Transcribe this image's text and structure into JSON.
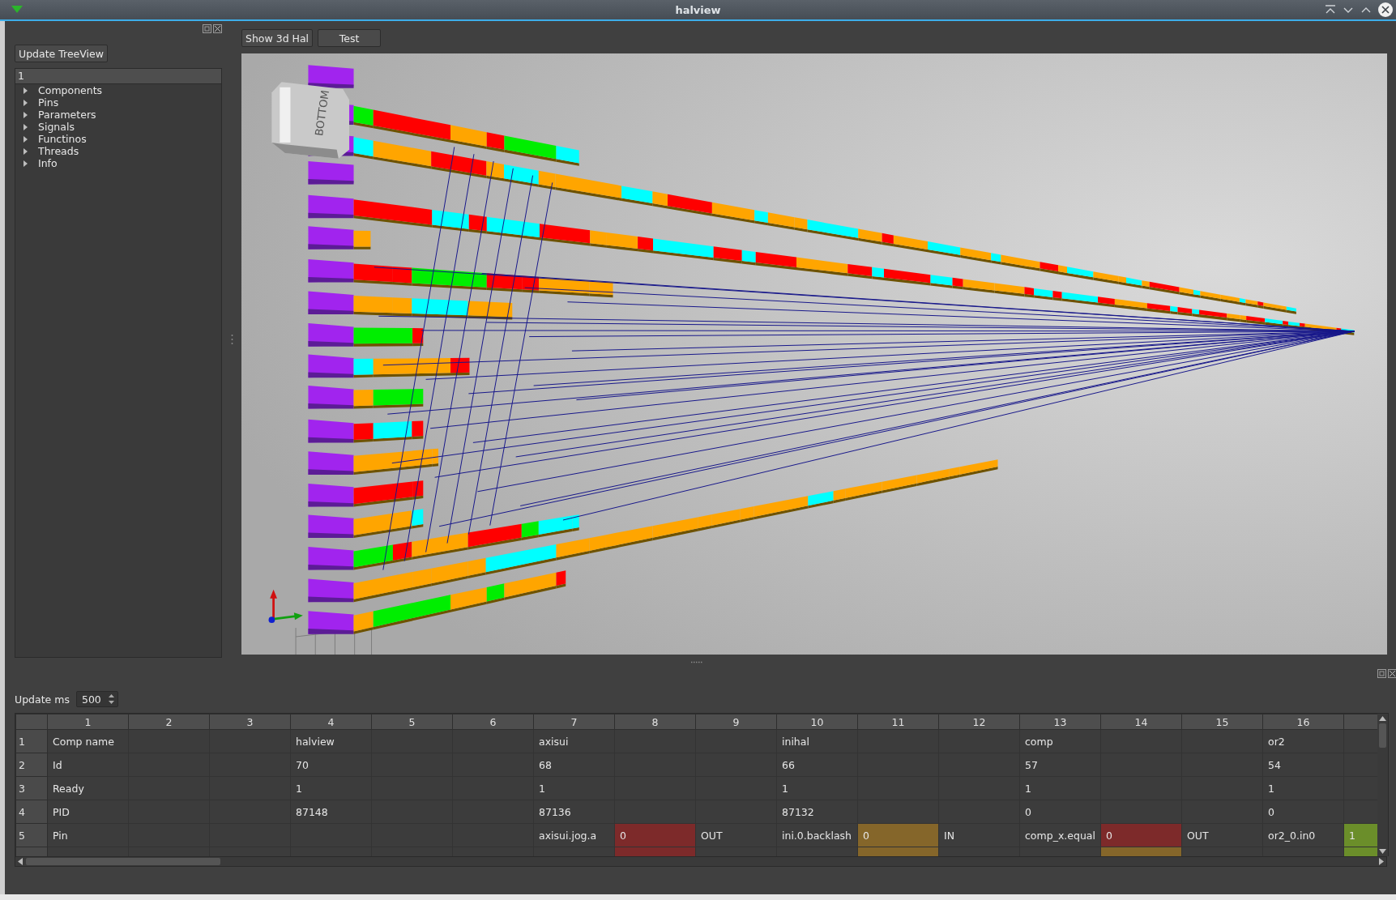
{
  "window": {
    "title": "halview"
  },
  "tree_panel": {
    "update_button": "Update TreeView",
    "header": "1",
    "items": [
      {
        "label": "Components",
        "expanded": false
      },
      {
        "label": "Pins",
        "expanded": false
      },
      {
        "label": "Parameters",
        "expanded": false
      },
      {
        "label": "Signals",
        "expanded": false
      },
      {
        "label": "Functinos",
        "expanded": false
      },
      {
        "label": "Threads",
        "expanded": false
      },
      {
        "label": "Info",
        "expanded": false
      }
    ]
  },
  "toolbar": {
    "buttons": [
      "Show 3d Hal",
      "Test"
    ]
  },
  "view": {
    "cube_label": "BOTTOM"
  },
  "bottom_panel": {
    "update_label": "Update ms",
    "update_value": "500"
  },
  "table": {
    "columns": [
      "1",
      "2",
      "3",
      "4",
      "5",
      "6",
      "7",
      "8",
      "9",
      "10",
      "11",
      "12",
      "13",
      "14",
      "15",
      "16"
    ],
    "rows": [
      {
        "header": "1",
        "cells": [
          "Comp name",
          null,
          null,
          "halview",
          null,
          null,
          "axisui",
          null,
          null,
          "inihal",
          null,
          null,
          "comp",
          null,
          null,
          "or2",
          null
        ]
      },
      {
        "header": "2",
        "cells": [
          "Id",
          null,
          null,
          "70",
          null,
          null,
          "68",
          null,
          null,
          "66",
          null,
          null,
          "57",
          null,
          null,
          "54",
          null
        ]
      },
      {
        "header": "3",
        "cells": [
          "Ready",
          null,
          null,
          "1",
          null,
          null,
          "1",
          null,
          null,
          "1",
          null,
          null,
          "1",
          null,
          null,
          "1",
          null
        ]
      },
      {
        "header": "4",
        "cells": [
          "PID",
          null,
          null,
          "87148",
          null,
          null,
          "87136",
          null,
          null,
          "87132",
          null,
          null,
          "0",
          null,
          null,
          "0",
          null
        ]
      },
      {
        "header": "5",
        "cells": [
          "Pin",
          null,
          null,
          null,
          null,
          null,
          "axisui.jog.a",
          {
            "text": "0",
            "color": "#7d2a2a"
          },
          "OUT",
          "ini.0.backlash",
          {
            "text": "0",
            "color": "#85662a"
          },
          "IN",
          "comp_x.equal",
          {
            "text": "0",
            "color": "#7d2a2a"
          },
          "OUT",
          "or2_0.in0",
          {
            "text": "1",
            "color": "#6b8e2a"
          }
        ]
      },
      {
        "cells": [
          null,
          null,
          null,
          null,
          null,
          null,
          null,
          {
            "color": "#7d2a2a"
          },
          null,
          null,
          {
            "color": "#85662a"
          },
          null,
          null,
          {
            "color": "#85662a"
          },
          null,
          null,
          {
            "color": "#6b8e2a"
          }
        ]
      }
    ]
  }
}
